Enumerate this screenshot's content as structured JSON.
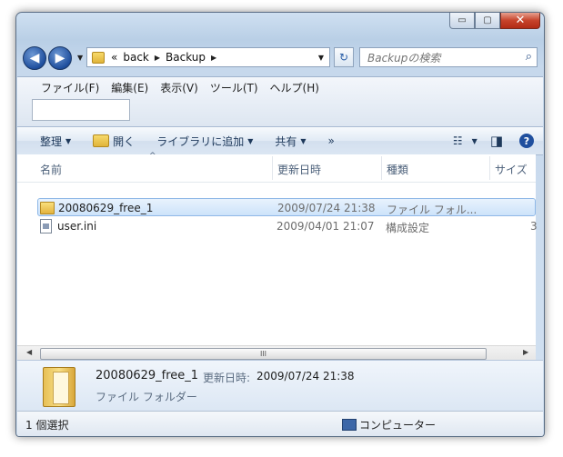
{
  "window": {
    "caption_buttons": [
      "minimize-icon",
      "maximize-icon",
      "close-icon"
    ],
    "caption_glyphs": {
      "minimize": "▭",
      "maximize": "▢",
      "close": "✕"
    }
  },
  "nav": {
    "back_glyph": "◀",
    "forward_glyph": "▶",
    "dropdown_glyph": "▼",
    "address": {
      "prefix": "«",
      "segments": [
        "back",
        "Backup"
      ],
      "sep_glyph": "▶",
      "dropdown_glyph": "▼"
    },
    "refresh_glyph": "↻",
    "search": {
      "placeholder": "Backupの検索",
      "icon": "search-icon",
      "glyph": "⌕"
    }
  },
  "menubar": {
    "items": [
      "ファイル(F)",
      "編集(E)",
      "表示(V)",
      "ツール(T)",
      "ヘルプ(H)"
    ]
  },
  "toolbar": {
    "organize": "整理",
    "open": "開く",
    "add_to_library": "ライブラリに追加",
    "share": "共有",
    "more": "»",
    "arrow": "▼",
    "view_glyph": "☷",
    "pane_glyph": "◨",
    "help_glyph": "?"
  },
  "columns": {
    "name": "名前",
    "date": "更新日時",
    "type": "種類",
    "size": "サイズ",
    "sort_glyph": "^"
  },
  "files": [
    {
      "name": "20080629_free_1",
      "date": "2009/07/24 21:38",
      "type": "ファイル フォル...",
      "size": "",
      "icon": "folder-icon",
      "selected": true
    },
    {
      "name": "user.ini",
      "date": "2009/04/01 21:07",
      "type": "構成設定",
      "size": "3",
      "icon": "ini-file-icon",
      "selected": false
    }
  ],
  "hscroll": {
    "left": "◀",
    "right": "▶",
    "grip": "III"
  },
  "details": {
    "name": "20080629_free_1",
    "date_label": "更新日時:",
    "date_value": "2009/07/24 21:38",
    "type": "ファイル フォルダー"
  },
  "status": {
    "selection": "1 個選択",
    "location": "コンピューター"
  },
  "colors": {
    "accent": "#3a6ea5",
    "selection": "#cde3fa"
  }
}
